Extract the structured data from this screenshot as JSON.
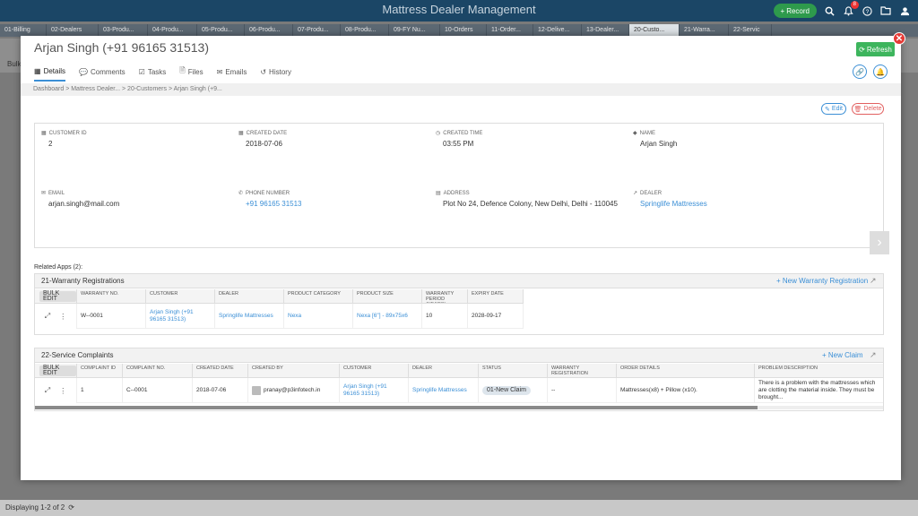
{
  "app": {
    "title": "Mattress Dealer Management",
    "record_label": "Record",
    "notif_count": "8"
  },
  "tabs": [
    "01-Billing",
    "02-Dealers",
    "03-Produ...",
    "04-Produ...",
    "05-Produ...",
    "06-Produ...",
    "07-Produ...",
    "08-Produ...",
    "09-FY Nu...",
    "10-Orders",
    "11-Order...",
    "12-Delive...",
    "13-Dealer...",
    "20-Custo...",
    "21-Warra...",
    "22-Servic"
  ],
  "footer": {
    "text": "Displaying 1-2 of 2"
  },
  "bg": {
    "bulk": "Bulk"
  },
  "modal": {
    "title": "Arjan Singh (+91 96165 31513)",
    "refresh": "Refresh",
    "tabs": [
      "Details",
      "Comments",
      "Tasks",
      "Files",
      "Emails",
      "History"
    ],
    "breadcrumb": "Dashboard  >  Mattress Dealer...  >  20-Customers  >  Arjan Singh (+9...",
    "edit": "Edit",
    "delete": "Delete"
  },
  "fields": {
    "customer_id": {
      "label": "Customer ID",
      "value": "2"
    },
    "created_date": {
      "label": "Created Date",
      "value": "2018-07-06"
    },
    "created_time": {
      "label": "Created Time",
      "value": "03:55 PM"
    },
    "name": {
      "label": "Name",
      "value": "Arjan Singh"
    },
    "email": {
      "label": "Email",
      "value": "arjan.singh@mail.com"
    },
    "phone": {
      "label": "Phone Number",
      "value": "+91 96165 31513"
    },
    "address": {
      "label": "Address",
      "value": "Plot No 24, Defence Colony, New Delhi, Delhi - 110045"
    },
    "dealer": {
      "label": "Dealer",
      "value": "Springlife Mattresses"
    }
  },
  "related": {
    "label": "Related Apps (2):",
    "warranty": {
      "title": "21-Warranty Registrations",
      "new_label": "New Warranty Registration",
      "bulk": "Bulk Edit",
      "headers": [
        "Warranty No.",
        "Customer",
        "Dealer",
        "Product Category",
        "Product Size",
        "Warranty Period (Years)",
        "Expiry Date"
      ],
      "row": [
        "W--0001",
        "Arjan Singh (+91 96165 31513)",
        "Springlife Mattresses",
        "Nexa",
        "Nexa [6\"] - 89x75x6",
        "10",
        "2028-09-17"
      ]
    },
    "complaints": {
      "title": "22-Service Complaints",
      "new_label": "New Claim",
      "bulk": "Bulk Edit",
      "headers": [
        "Complaint ID",
        "Complaint No.",
        "Created Date",
        "Created By",
        "Customer",
        "Dealer",
        "Status",
        "Warranty Registration",
        "Order Details",
        "Problem Description"
      ],
      "row": [
        "1",
        "C--0001",
        "2018-07-06",
        "pranay@p3infotech.in",
        "Arjan Singh (+91 96165 31513)",
        "Springlife Mattresses",
        "01-New Claim",
        "--",
        "Mattresses(x8) + Pillow (x10).",
        "There is a problem with the mattresses which are clotting the material inside. They must be brought..."
      ]
    }
  },
  "icons": {
    "accent": "#3b8fd6",
    "success": "#3db55d",
    "danger": "#e53935"
  }
}
